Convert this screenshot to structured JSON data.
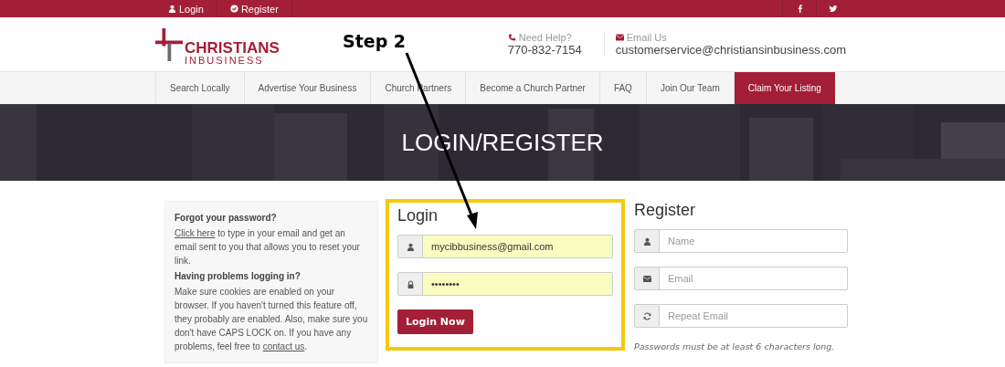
{
  "top_bar": {
    "links": [
      "Login",
      "Register"
    ]
  },
  "logo": {
    "line1": "CHRISTIANS",
    "line2": "INBUSINESS"
  },
  "annotation": {
    "label": "Step 2"
  },
  "contact": [
    {
      "kind": "phone",
      "label": "Need Help?",
      "value": "770-832-7154"
    },
    {
      "kind": "email",
      "label": "Email Us",
      "value": "customerservice@christiansinbusiness.com"
    }
  ],
  "nav": [
    {
      "label": "Search Locally",
      "selected": false
    },
    {
      "label": "Advertise Your Business",
      "selected": false
    },
    {
      "label": "Church Partners",
      "selected": false
    },
    {
      "label": "Become a Church Partner",
      "selected": false
    },
    {
      "label": "FAQ",
      "selected": false
    },
    {
      "label": "Join Our Team",
      "selected": false
    },
    {
      "label": "Claim Your Listing",
      "selected": true
    }
  ],
  "banner": {
    "title": "LOGIN/REGISTER"
  },
  "help": {
    "heading1": "Forgot your password?",
    "link1": "Click here",
    "text1": " to type in your email and get an email sent to you that allows you to reset your link.",
    "heading2": "Having problems logging in?",
    "text2": "Make sure cookies are enabled on your browser. If you haven't turned this feature off, they probably are enabled. Also, make sure you don't have CAPS LOCK on. If you have any problems, feel free to ",
    "link2": "contact us",
    "text2_end": "."
  },
  "login": {
    "title": "Login",
    "highlighted": true,
    "fields": [
      {
        "kind": "user",
        "value": "mycibbusiness@gmail.com"
      },
      {
        "kind": "lock",
        "value": "••••••••"
      }
    ],
    "button": "Login Now"
  },
  "register": {
    "title": "Register",
    "fields": [
      {
        "kind": "user",
        "placeholder": "Name"
      },
      {
        "kind": "envelope",
        "placeholder": "Email"
      },
      {
        "kind": "refresh",
        "placeholder": "Repeat Email"
      }
    ],
    "note": "Passwords must be at least 6 characters long."
  }
}
